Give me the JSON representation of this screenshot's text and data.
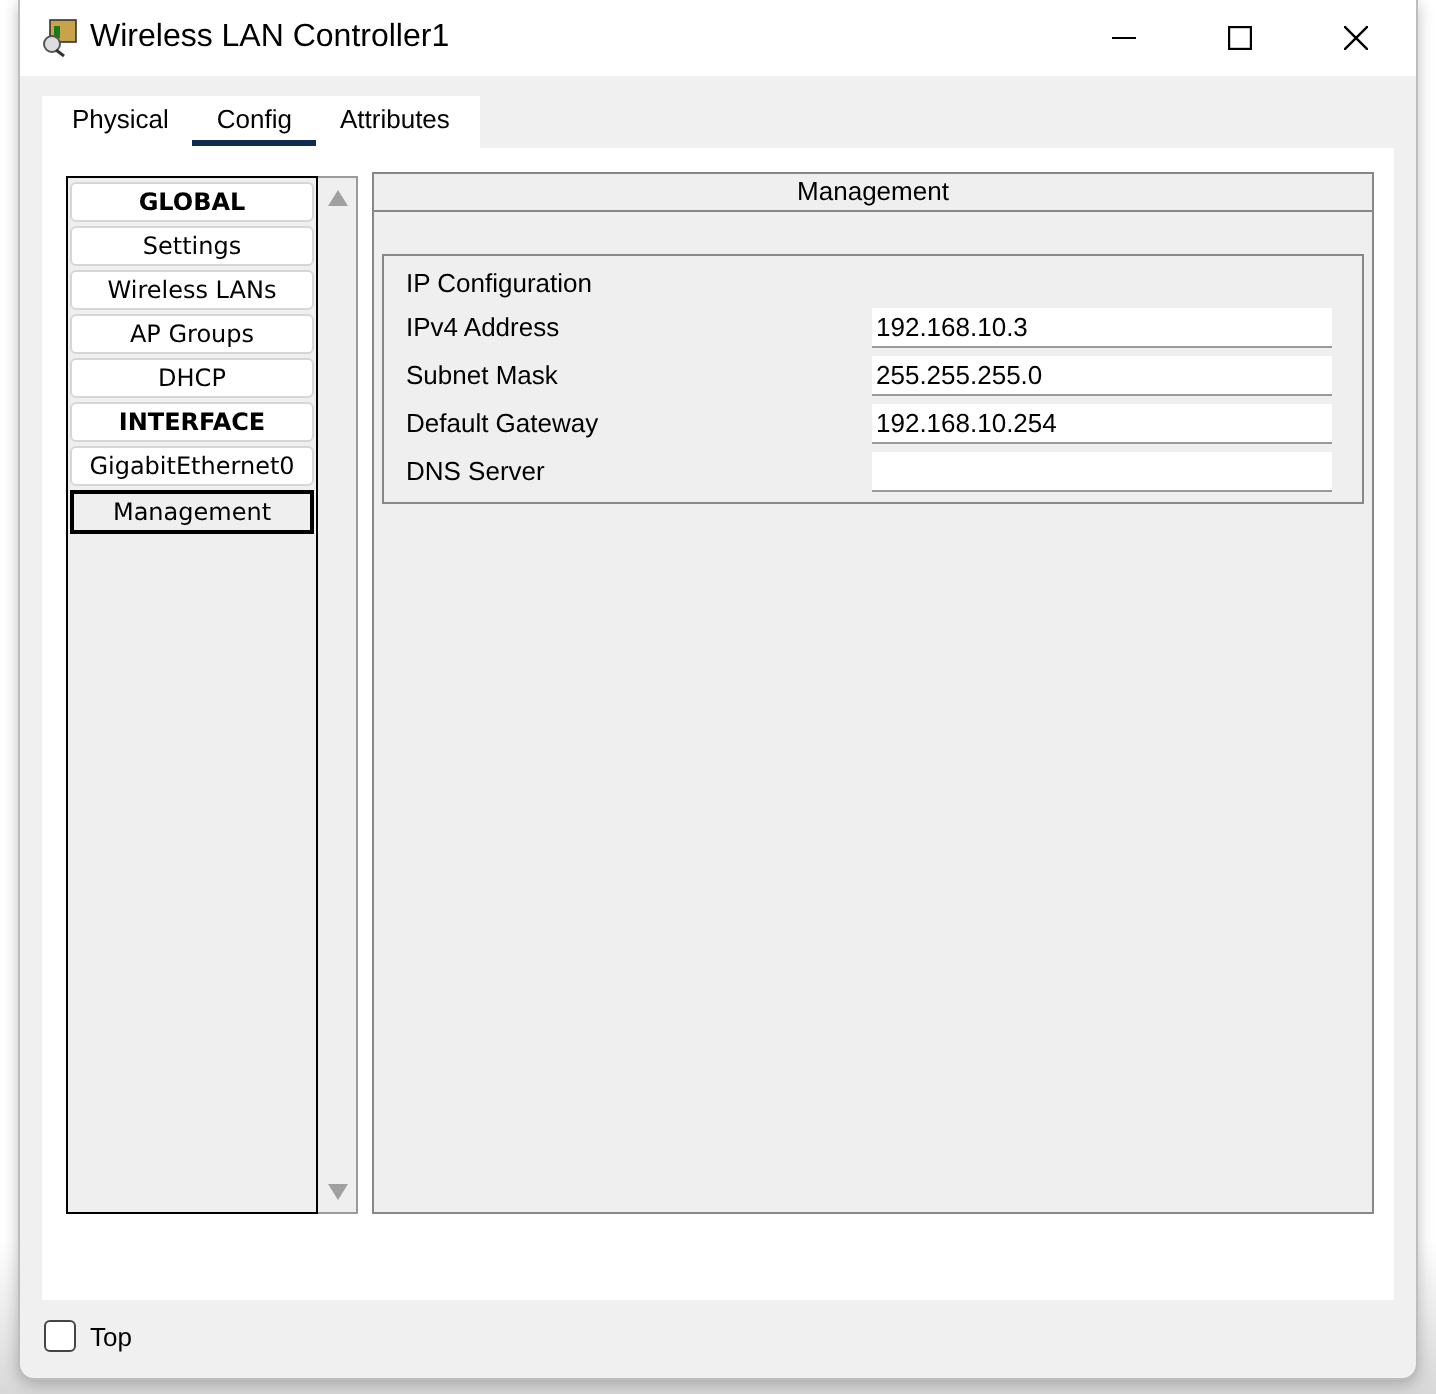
{
  "window": {
    "title": "Wireless LAN Controller1"
  },
  "tabs": [
    {
      "label": "Physical",
      "selected": false
    },
    {
      "label": "Config",
      "selected": true
    },
    {
      "label": "Attributes",
      "selected": false
    }
  ],
  "sidebar": {
    "items": [
      {
        "label": "GLOBAL",
        "kind": "header",
        "selected": false
      },
      {
        "label": "Settings",
        "kind": "item",
        "selected": false
      },
      {
        "label": "Wireless LANs",
        "kind": "item",
        "selected": false
      },
      {
        "label": "AP Groups",
        "kind": "item",
        "selected": false
      },
      {
        "label": "DHCP",
        "kind": "item",
        "selected": false
      },
      {
        "label": "INTERFACE",
        "kind": "header",
        "selected": false
      },
      {
        "label": "GigabitEthernet0",
        "kind": "item",
        "selected": false
      },
      {
        "label": "Management",
        "kind": "item",
        "selected": true
      }
    ]
  },
  "panel": {
    "title": "Management",
    "group_title": "IP Configuration",
    "fields": [
      {
        "label": "IPv4 Address",
        "value": "192.168.10.3"
      },
      {
        "label": "Subnet Mask",
        "value": "255.255.255.0"
      },
      {
        "label": "Default Gateway",
        "value": "192.168.10.254"
      },
      {
        "label": "DNS Server"
      }
    ]
  },
  "top_checkbox": {
    "label": "Top",
    "checked": false
  }
}
